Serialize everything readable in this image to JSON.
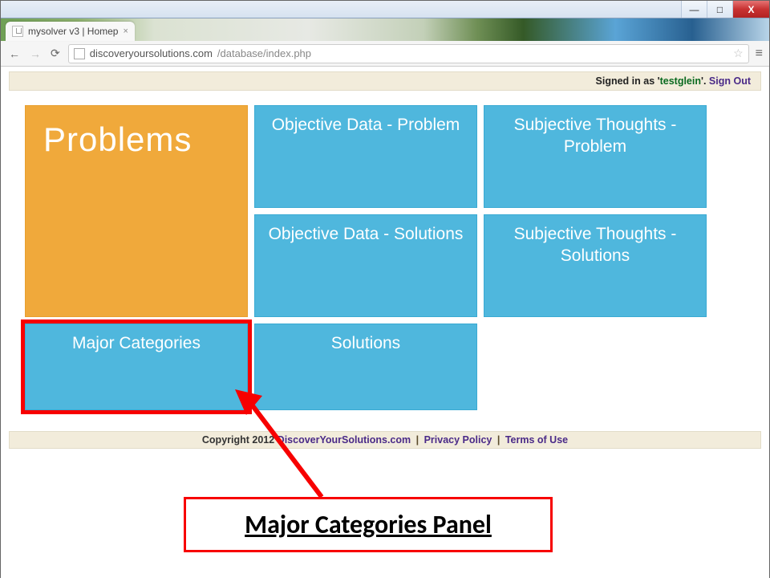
{
  "window": {
    "minimize_glyph": "—",
    "maximize_glyph": "□",
    "close_glyph": "X"
  },
  "browser": {
    "tab_title": "mysolver v3 | Homep",
    "tab_close": "×",
    "back": "←",
    "forward": "→",
    "reload": "⟳",
    "url_host": "discoveryoursolutions.com",
    "url_path": "/database/index.php",
    "star_glyph": "☆",
    "menu_glyph": "≡"
  },
  "auth": {
    "prefix": "Signed in as '",
    "user": "testglein",
    "suffix": "'. ",
    "signout": "Sign Out"
  },
  "tiles": {
    "problems": "Problems",
    "objective_problem": "Objective Data - Problem",
    "subjective_problem": "Subjective Thoughts - Problem",
    "objective_solutions": "Objective Data - Solutions",
    "subjective_solutions": "Subjective Thoughts - Solutions",
    "major_categories": "Major Categories",
    "solutions": "Solutions"
  },
  "footer": {
    "copyright": "Copyright 2012 ",
    "site": "DiscoverYourSolutions.com",
    "sep": " | ",
    "privacy": "Privacy Policy",
    "terms": "Terms of Use"
  },
  "annotation": {
    "label": "Major Categories Panel"
  }
}
